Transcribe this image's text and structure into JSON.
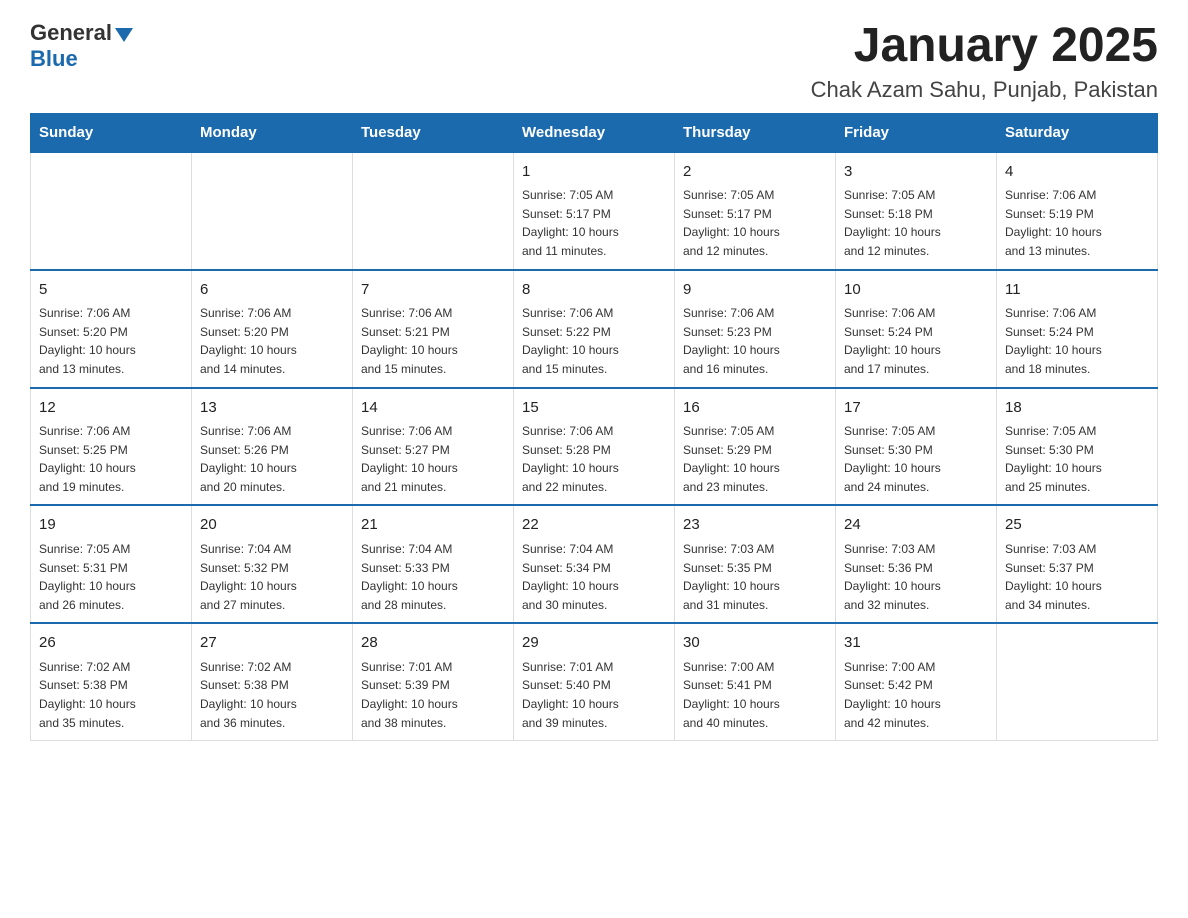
{
  "header": {
    "logo_general": "General",
    "logo_blue": "Blue",
    "month_title": "January 2025",
    "location": "Chak Azam Sahu, Punjab, Pakistan"
  },
  "days_of_week": [
    "Sunday",
    "Monday",
    "Tuesday",
    "Wednesday",
    "Thursday",
    "Friday",
    "Saturday"
  ],
  "weeks": [
    [
      {
        "day": "",
        "info": ""
      },
      {
        "day": "",
        "info": ""
      },
      {
        "day": "",
        "info": ""
      },
      {
        "day": "1",
        "info": "Sunrise: 7:05 AM\nSunset: 5:17 PM\nDaylight: 10 hours\nand 11 minutes."
      },
      {
        "day": "2",
        "info": "Sunrise: 7:05 AM\nSunset: 5:17 PM\nDaylight: 10 hours\nand 12 minutes."
      },
      {
        "day": "3",
        "info": "Sunrise: 7:05 AM\nSunset: 5:18 PM\nDaylight: 10 hours\nand 12 minutes."
      },
      {
        "day": "4",
        "info": "Sunrise: 7:06 AM\nSunset: 5:19 PM\nDaylight: 10 hours\nand 13 minutes."
      }
    ],
    [
      {
        "day": "5",
        "info": "Sunrise: 7:06 AM\nSunset: 5:20 PM\nDaylight: 10 hours\nand 13 minutes."
      },
      {
        "day": "6",
        "info": "Sunrise: 7:06 AM\nSunset: 5:20 PM\nDaylight: 10 hours\nand 14 minutes."
      },
      {
        "day": "7",
        "info": "Sunrise: 7:06 AM\nSunset: 5:21 PM\nDaylight: 10 hours\nand 15 minutes."
      },
      {
        "day": "8",
        "info": "Sunrise: 7:06 AM\nSunset: 5:22 PM\nDaylight: 10 hours\nand 15 minutes."
      },
      {
        "day": "9",
        "info": "Sunrise: 7:06 AM\nSunset: 5:23 PM\nDaylight: 10 hours\nand 16 minutes."
      },
      {
        "day": "10",
        "info": "Sunrise: 7:06 AM\nSunset: 5:24 PM\nDaylight: 10 hours\nand 17 minutes."
      },
      {
        "day": "11",
        "info": "Sunrise: 7:06 AM\nSunset: 5:24 PM\nDaylight: 10 hours\nand 18 minutes."
      }
    ],
    [
      {
        "day": "12",
        "info": "Sunrise: 7:06 AM\nSunset: 5:25 PM\nDaylight: 10 hours\nand 19 minutes."
      },
      {
        "day": "13",
        "info": "Sunrise: 7:06 AM\nSunset: 5:26 PM\nDaylight: 10 hours\nand 20 minutes."
      },
      {
        "day": "14",
        "info": "Sunrise: 7:06 AM\nSunset: 5:27 PM\nDaylight: 10 hours\nand 21 minutes."
      },
      {
        "day": "15",
        "info": "Sunrise: 7:06 AM\nSunset: 5:28 PM\nDaylight: 10 hours\nand 22 minutes."
      },
      {
        "day": "16",
        "info": "Sunrise: 7:05 AM\nSunset: 5:29 PM\nDaylight: 10 hours\nand 23 minutes."
      },
      {
        "day": "17",
        "info": "Sunrise: 7:05 AM\nSunset: 5:30 PM\nDaylight: 10 hours\nand 24 minutes."
      },
      {
        "day": "18",
        "info": "Sunrise: 7:05 AM\nSunset: 5:30 PM\nDaylight: 10 hours\nand 25 minutes."
      }
    ],
    [
      {
        "day": "19",
        "info": "Sunrise: 7:05 AM\nSunset: 5:31 PM\nDaylight: 10 hours\nand 26 minutes."
      },
      {
        "day": "20",
        "info": "Sunrise: 7:04 AM\nSunset: 5:32 PM\nDaylight: 10 hours\nand 27 minutes."
      },
      {
        "day": "21",
        "info": "Sunrise: 7:04 AM\nSunset: 5:33 PM\nDaylight: 10 hours\nand 28 minutes."
      },
      {
        "day": "22",
        "info": "Sunrise: 7:04 AM\nSunset: 5:34 PM\nDaylight: 10 hours\nand 30 minutes."
      },
      {
        "day": "23",
        "info": "Sunrise: 7:03 AM\nSunset: 5:35 PM\nDaylight: 10 hours\nand 31 minutes."
      },
      {
        "day": "24",
        "info": "Sunrise: 7:03 AM\nSunset: 5:36 PM\nDaylight: 10 hours\nand 32 minutes."
      },
      {
        "day": "25",
        "info": "Sunrise: 7:03 AM\nSunset: 5:37 PM\nDaylight: 10 hours\nand 34 minutes."
      }
    ],
    [
      {
        "day": "26",
        "info": "Sunrise: 7:02 AM\nSunset: 5:38 PM\nDaylight: 10 hours\nand 35 minutes."
      },
      {
        "day": "27",
        "info": "Sunrise: 7:02 AM\nSunset: 5:38 PM\nDaylight: 10 hours\nand 36 minutes."
      },
      {
        "day": "28",
        "info": "Sunrise: 7:01 AM\nSunset: 5:39 PM\nDaylight: 10 hours\nand 38 minutes."
      },
      {
        "day": "29",
        "info": "Sunrise: 7:01 AM\nSunset: 5:40 PM\nDaylight: 10 hours\nand 39 minutes."
      },
      {
        "day": "30",
        "info": "Sunrise: 7:00 AM\nSunset: 5:41 PM\nDaylight: 10 hours\nand 40 minutes."
      },
      {
        "day": "31",
        "info": "Sunrise: 7:00 AM\nSunset: 5:42 PM\nDaylight: 10 hours\nand 42 minutes."
      },
      {
        "day": "",
        "info": ""
      }
    ]
  ]
}
